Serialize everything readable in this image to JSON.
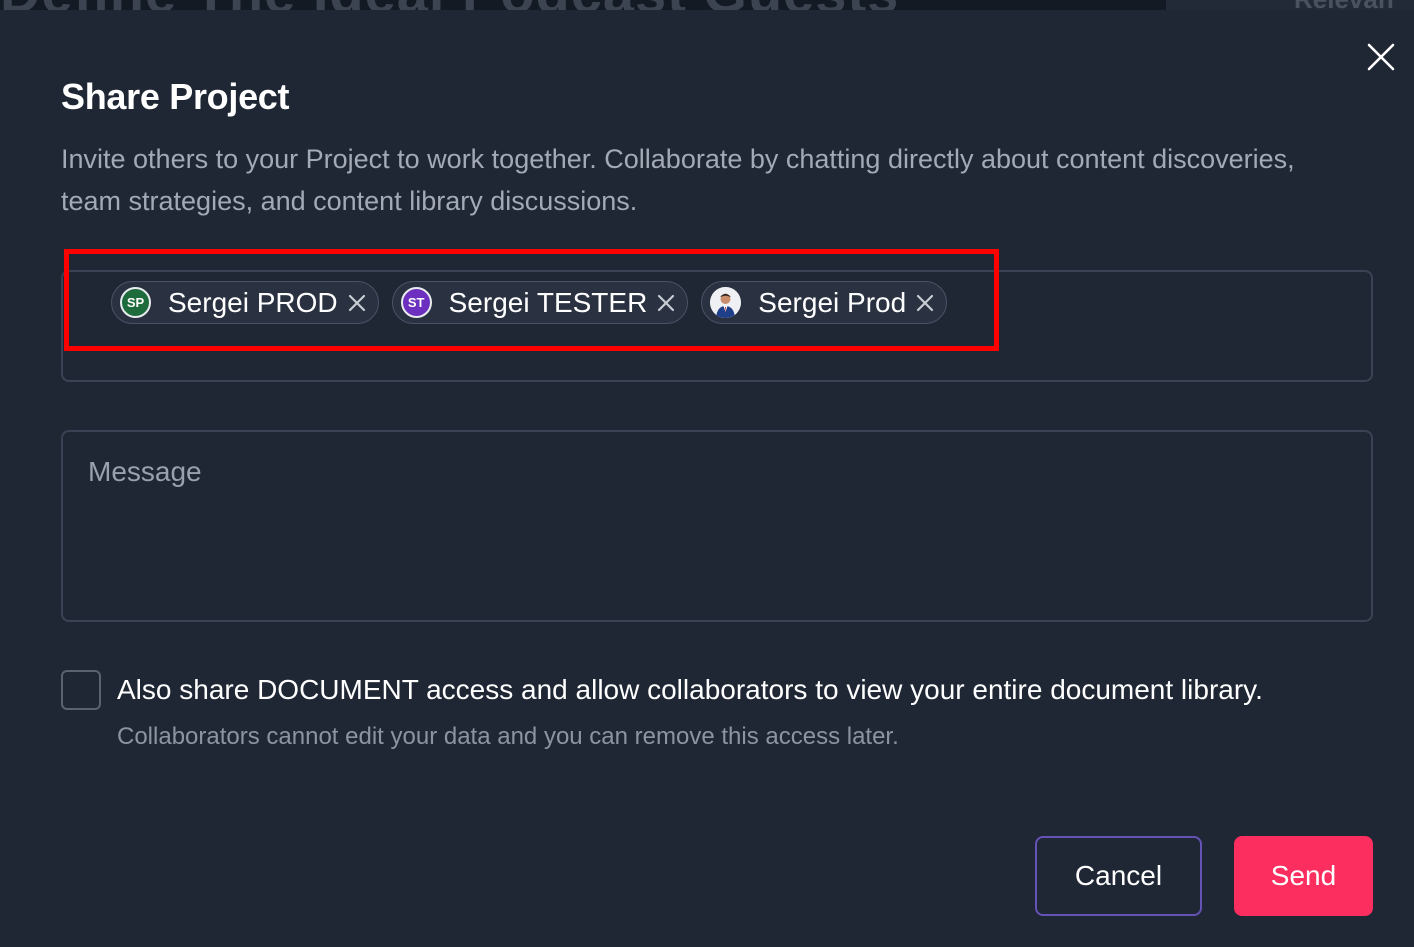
{
  "backdrop": {
    "title": "Define The Ideal Podcast Guests",
    "right_label": "Relevan"
  },
  "dialog": {
    "title": "Share Project",
    "description": "Invite others to your Project to work together. Collaborate by chatting directly about content discoveries, team strategies, and content library discussions.",
    "close_icon": "close-icon"
  },
  "recipients": [
    {
      "initials": "SP",
      "name": "Sergei PROD",
      "avatar_color": "#1e6b3c"
    },
    {
      "initials": "ST",
      "name": "Sergei TESTER",
      "avatar_color": "#6d2fbf"
    },
    {
      "initials": "",
      "name": "Sergei Prod",
      "avatar_color": "photo"
    }
  ],
  "message": {
    "placeholder": "Message",
    "value": ""
  },
  "document_access": {
    "checked": false,
    "label": "Also share DOCUMENT access and allow collaborators to view your entire document library.",
    "help": "Collaborators cannot edit your data and you can remove this access later."
  },
  "actions": {
    "cancel_label": "Cancel",
    "send_label": "Send"
  },
  "colors": {
    "background": "#1f2735",
    "accent_send": "#fb2e5f",
    "cancel_border": "#6452b5",
    "highlight": "#ff0000"
  }
}
